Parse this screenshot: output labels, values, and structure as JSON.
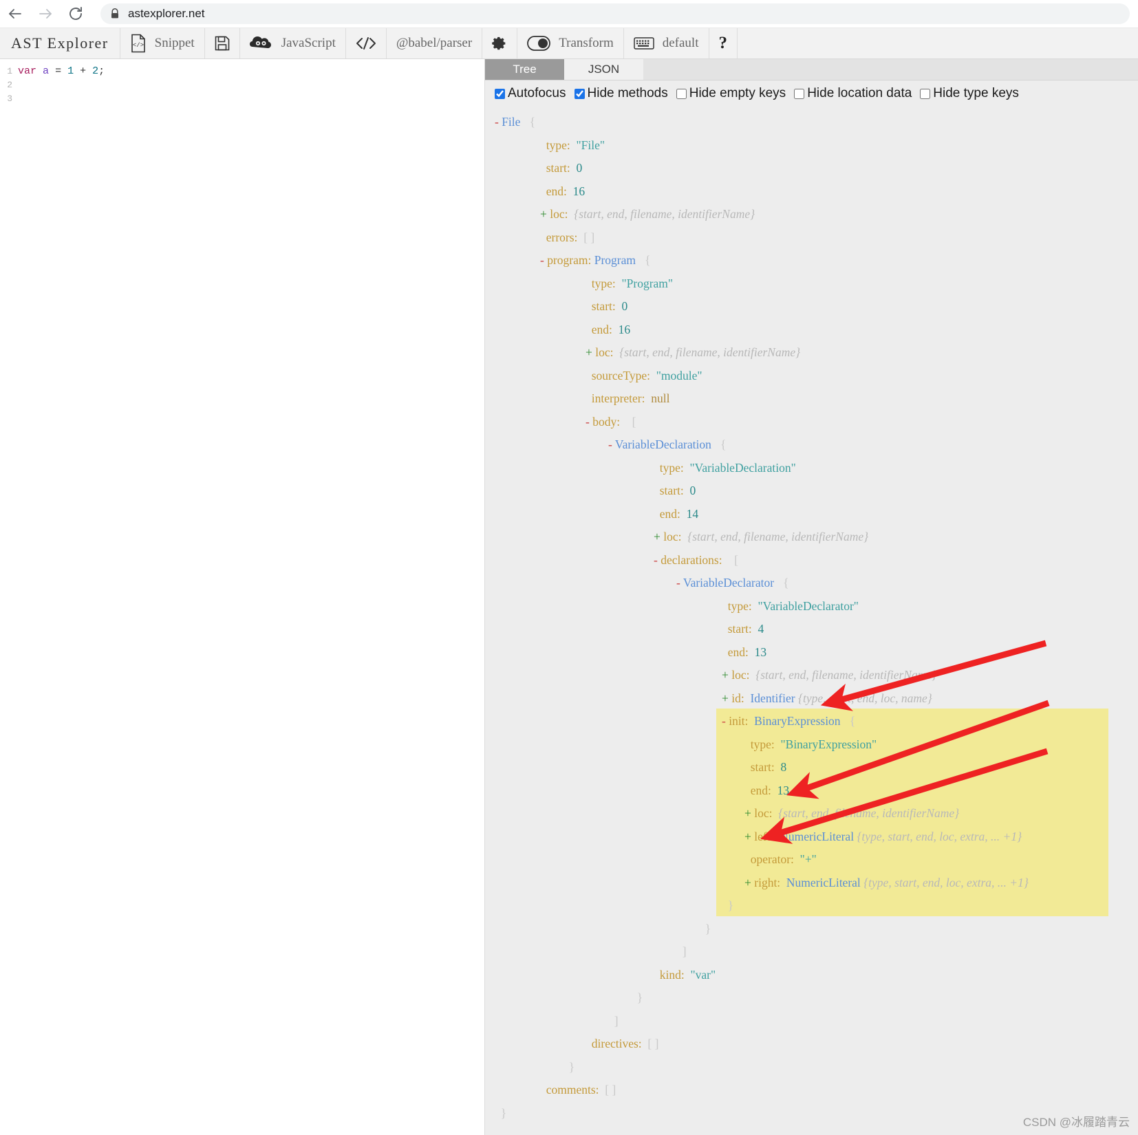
{
  "browser": {
    "back_icon": "arrow-left-icon",
    "forward_icon": "arrow-right-icon",
    "reload_icon": "reload-icon",
    "lock_icon": "lock-icon",
    "url": "astexplorer.net"
  },
  "toolbar": {
    "brand": "AST Explorer",
    "snippet_icon": "file-code-icon",
    "snippet_label": "Snippet",
    "save_icon": "floppy-disk-icon",
    "language_icon": "babel-logo-icon",
    "language_label": "JavaScript",
    "parser_icon": "code-brackets-icon",
    "parser_label": "@babel/parser",
    "settings_icon": "gear-icon",
    "transform_icon": "toggle-circle-icon",
    "transform_label": "Transform",
    "keymap_icon": "keyboard-icon",
    "keymap_label": "default",
    "help_icon": "question-mark-icon"
  },
  "editor": {
    "lines": [
      {
        "num": "1",
        "tokens": [
          {
            "t": "var",
            "c": "tok-kw"
          },
          {
            "t": " ",
            "c": "tok-punct"
          },
          {
            "t": "a",
            "c": "tok-var"
          },
          {
            "t": " ",
            "c": "tok-punct"
          },
          {
            "t": "=",
            "c": "tok-op"
          },
          {
            "t": " ",
            "c": "tok-punct"
          },
          {
            "t": "1",
            "c": "tok-num"
          },
          {
            "t": " ",
            "c": "tok-punct"
          },
          {
            "t": "+",
            "c": "tok-op"
          },
          {
            "t": " ",
            "c": "tok-punct"
          },
          {
            "t": "2",
            "c": "tok-num"
          },
          {
            "t": ";",
            "c": "tok-punct"
          }
        ],
        "plain": "var a = 1 + 2;"
      },
      {
        "num": "2",
        "tokens": [],
        "plain": ""
      },
      {
        "num": "3",
        "tokens": [],
        "plain": ""
      }
    ]
  },
  "ast_panel": {
    "tabs": [
      {
        "label": "Tree",
        "active": true
      },
      {
        "label": "JSON",
        "active": false
      }
    ],
    "options": [
      {
        "label": "Autofocus",
        "checked": true
      },
      {
        "label": "Hide methods",
        "checked": true
      },
      {
        "label": "Hide empty keys",
        "checked": false
      },
      {
        "label": "Hide location data",
        "checked": false
      },
      {
        "label": "Hide type keys",
        "checked": false
      }
    ],
    "tree_rows": [
      {
        "indent": 0,
        "toggle": "-",
        "segments": [
          {
            "text": "File",
            "cls": "nodetype"
          },
          {
            "text": "   ",
            "cls": "brace"
          },
          {
            "text": "{",
            "cls": "brace"
          }
        ]
      },
      {
        "indent": 2,
        "toggle": "",
        "segments": [
          {
            "text": "type:",
            "cls": "key"
          },
          {
            "text": "  ",
            "cls": "key"
          },
          {
            "text": "\"File\"",
            "cls": "str"
          }
        ]
      },
      {
        "indent": 2,
        "toggle": "",
        "segments": [
          {
            "text": "start:",
            "cls": "key"
          },
          {
            "text": "  ",
            "cls": "key"
          },
          {
            "text": "0",
            "cls": "num"
          }
        ]
      },
      {
        "indent": 2,
        "toggle": "",
        "segments": [
          {
            "text": "end:",
            "cls": "key"
          },
          {
            "text": "  ",
            "cls": "key"
          },
          {
            "text": "16",
            "cls": "num"
          }
        ]
      },
      {
        "indent": 2,
        "toggle": "+",
        "segments": [
          {
            "text": "loc:",
            "cls": "key"
          },
          {
            "text": "  ",
            "cls": "key"
          },
          {
            "text": "{start, end, filename, identifierName}",
            "cls": "preview"
          }
        ]
      },
      {
        "indent": 2,
        "toggle": "",
        "segments": [
          {
            "text": "errors:",
            "cls": "key"
          },
          {
            "text": "  ",
            "cls": "key"
          },
          {
            "text": "[ ]",
            "cls": "brace"
          }
        ]
      },
      {
        "indent": 2,
        "toggle": "-",
        "segments": [
          {
            "text": "program:",
            "cls": "key"
          },
          {
            "text": " ",
            "cls": "key"
          },
          {
            "text": "Program",
            "cls": "nodetype"
          },
          {
            "text": "   ",
            "cls": "brace"
          },
          {
            "text": "{",
            "cls": "brace"
          }
        ]
      },
      {
        "indent": 4,
        "toggle": "",
        "segments": [
          {
            "text": "type:",
            "cls": "key"
          },
          {
            "text": "  ",
            "cls": "key"
          },
          {
            "text": "\"Program\"",
            "cls": "str"
          }
        ]
      },
      {
        "indent": 4,
        "toggle": "",
        "segments": [
          {
            "text": "start:",
            "cls": "key"
          },
          {
            "text": "  ",
            "cls": "key"
          },
          {
            "text": "0",
            "cls": "num"
          }
        ]
      },
      {
        "indent": 4,
        "toggle": "",
        "segments": [
          {
            "text": "end:",
            "cls": "key"
          },
          {
            "text": "  ",
            "cls": "key"
          },
          {
            "text": "16",
            "cls": "num"
          }
        ]
      },
      {
        "indent": 4,
        "toggle": "+",
        "segments": [
          {
            "text": "loc:",
            "cls": "key"
          },
          {
            "text": "  ",
            "cls": "key"
          },
          {
            "text": "{start, end, filename, identifierName}",
            "cls": "preview"
          }
        ]
      },
      {
        "indent": 4,
        "toggle": "",
        "segments": [
          {
            "text": "sourceType:",
            "cls": "key"
          },
          {
            "text": "  ",
            "cls": "key"
          },
          {
            "text": "\"module\"",
            "cls": "str"
          }
        ]
      },
      {
        "indent": 4,
        "toggle": "",
        "segments": [
          {
            "text": "interpreter:",
            "cls": "key"
          },
          {
            "text": "  ",
            "cls": "key"
          },
          {
            "text": "null",
            "cls": "nul"
          }
        ]
      },
      {
        "indent": 4,
        "toggle": "-",
        "segments": [
          {
            "text": "body:",
            "cls": "key"
          },
          {
            "text": "    ",
            "cls": "key"
          },
          {
            "text": "[",
            "cls": "brace"
          }
        ]
      },
      {
        "indent": 5,
        "toggle": "-",
        "segments": [
          {
            "text": "VariableDeclaration",
            "cls": "nodetype"
          },
          {
            "text": "   ",
            "cls": "brace"
          },
          {
            "text": "{",
            "cls": "brace"
          }
        ]
      },
      {
        "indent": 7,
        "toggle": "",
        "segments": [
          {
            "text": "type:",
            "cls": "key"
          },
          {
            "text": "  ",
            "cls": "key"
          },
          {
            "text": "\"VariableDeclaration\"",
            "cls": "str"
          }
        ]
      },
      {
        "indent": 7,
        "toggle": "",
        "segments": [
          {
            "text": "start:",
            "cls": "key"
          },
          {
            "text": "  ",
            "cls": "key"
          },
          {
            "text": "0",
            "cls": "num"
          }
        ]
      },
      {
        "indent": 7,
        "toggle": "",
        "segments": [
          {
            "text": "end:",
            "cls": "key"
          },
          {
            "text": "  ",
            "cls": "key"
          },
          {
            "text": "14",
            "cls": "num"
          }
        ]
      },
      {
        "indent": 7,
        "toggle": "+",
        "segments": [
          {
            "text": "loc:",
            "cls": "key"
          },
          {
            "text": "  ",
            "cls": "key"
          },
          {
            "text": "{start, end, filename, identifierName}",
            "cls": "preview"
          }
        ]
      },
      {
        "indent": 7,
        "toggle": "-",
        "segments": [
          {
            "text": "declarations:",
            "cls": "key"
          },
          {
            "text": "    ",
            "cls": "key"
          },
          {
            "text": "[",
            "cls": "brace"
          }
        ]
      },
      {
        "indent": 8,
        "toggle": "-",
        "segments": [
          {
            "text": "VariableDeclarator",
            "cls": "nodetype"
          },
          {
            "text": "   ",
            "cls": "brace"
          },
          {
            "text": "{",
            "cls": "brace"
          }
        ]
      },
      {
        "indent": 10,
        "toggle": "",
        "segments": [
          {
            "text": "type:",
            "cls": "key"
          },
          {
            "text": "  ",
            "cls": "key"
          },
          {
            "text": "\"VariableDeclarator\"",
            "cls": "str"
          }
        ]
      },
      {
        "indent": 10,
        "toggle": "",
        "segments": [
          {
            "text": "start:",
            "cls": "key"
          },
          {
            "text": "  ",
            "cls": "key"
          },
          {
            "text": "4",
            "cls": "num"
          }
        ]
      },
      {
        "indent": 10,
        "toggle": "",
        "segments": [
          {
            "text": "end:",
            "cls": "key"
          },
          {
            "text": "  ",
            "cls": "key"
          },
          {
            "text": "13",
            "cls": "num"
          }
        ]
      },
      {
        "indent": 10,
        "toggle": "+",
        "segments": [
          {
            "text": "loc:",
            "cls": "key"
          },
          {
            "text": "  ",
            "cls": "key"
          },
          {
            "text": "{start, end, filename, identifierName}",
            "cls": "preview"
          }
        ]
      },
      {
        "indent": 10,
        "toggle": "+",
        "segments": [
          {
            "text": "id:",
            "cls": "key"
          },
          {
            "text": "  ",
            "cls": "key"
          },
          {
            "text": "Identifier",
            "cls": "nodetype"
          },
          {
            "text": " ",
            "cls": "brace"
          },
          {
            "text": "{type, start, end, loc, name}",
            "cls": "preview"
          }
        ]
      },
      {
        "indent": 10,
        "toggle": "-",
        "highlight": true,
        "segments": [
          {
            "text": "init:",
            "cls": "key"
          },
          {
            "text": "  ",
            "cls": "key"
          },
          {
            "text": "BinaryExpression",
            "cls": "nodetype"
          },
          {
            "text": "   ",
            "cls": "brace"
          },
          {
            "text": "{",
            "cls": "brace"
          }
        ]
      },
      {
        "indent": 11,
        "toggle": "",
        "highlight": true,
        "segments": [
          {
            "text": "type:",
            "cls": "key"
          },
          {
            "text": "  ",
            "cls": "key"
          },
          {
            "text": "\"BinaryExpression\"",
            "cls": "str"
          }
        ]
      },
      {
        "indent": 11,
        "toggle": "",
        "highlight": true,
        "segments": [
          {
            "text": "start:",
            "cls": "key"
          },
          {
            "text": "  ",
            "cls": "key"
          },
          {
            "text": "8",
            "cls": "num"
          }
        ]
      },
      {
        "indent": 11,
        "toggle": "",
        "highlight": true,
        "segments": [
          {
            "text": "end:",
            "cls": "key"
          },
          {
            "text": "  ",
            "cls": "key"
          },
          {
            "text": "13",
            "cls": "num"
          }
        ]
      },
      {
        "indent": 11,
        "toggle": "+",
        "highlight": true,
        "segments": [
          {
            "text": "loc:",
            "cls": "key"
          },
          {
            "text": "  ",
            "cls": "key"
          },
          {
            "text": "{start, end, filename, identifierName}",
            "cls": "preview"
          }
        ]
      },
      {
        "indent": 11,
        "toggle": "+",
        "highlight": true,
        "segments": [
          {
            "text": "left:",
            "cls": "key"
          },
          {
            "text": "  ",
            "cls": "key"
          },
          {
            "text": "NumericLiteral",
            "cls": "nodetype"
          },
          {
            "text": " ",
            "cls": "brace"
          },
          {
            "text": "{type, start, end, loc, extra, ... +1}",
            "cls": "preview"
          }
        ]
      },
      {
        "indent": 11,
        "toggle": "",
        "highlight": true,
        "segments": [
          {
            "text": "operator:",
            "cls": "key"
          },
          {
            "text": "  ",
            "cls": "key"
          },
          {
            "text": "\"+\"",
            "cls": "str"
          }
        ]
      },
      {
        "indent": 11,
        "toggle": "+",
        "highlight": true,
        "segments": [
          {
            "text": "right:",
            "cls": "key"
          },
          {
            "text": "  ",
            "cls": "key"
          },
          {
            "text": "NumericLiteral",
            "cls": "nodetype"
          },
          {
            "text": " ",
            "cls": "brace"
          },
          {
            "text": "{type, start, end, loc, extra, ... +1}",
            "cls": "preview"
          }
        ]
      },
      {
        "indent": 10,
        "toggle": "",
        "highlight": true,
        "segments": [
          {
            "text": "}",
            "cls": "brace"
          }
        ]
      },
      {
        "indent": 9,
        "toggle": "",
        "segments": [
          {
            "text": "}",
            "cls": "brace"
          }
        ]
      },
      {
        "indent": 8,
        "toggle": "",
        "segments": [
          {
            "text": "]",
            "cls": "brace"
          }
        ]
      },
      {
        "indent": 7,
        "toggle": "",
        "segments": [
          {
            "text": "kind:",
            "cls": "key"
          },
          {
            "text": "  ",
            "cls": "key"
          },
          {
            "text": "\"var\"",
            "cls": "str"
          }
        ]
      },
      {
        "indent": 6,
        "toggle": "",
        "segments": [
          {
            "text": "}",
            "cls": "brace"
          }
        ]
      },
      {
        "indent": 5,
        "toggle": "",
        "segments": [
          {
            "text": "]",
            "cls": "brace"
          }
        ]
      },
      {
        "indent": 4,
        "toggle": "",
        "segments": [
          {
            "text": "directives:",
            "cls": "key"
          },
          {
            "text": "  ",
            "cls": "key"
          },
          {
            "text": "[ ]",
            "cls": "brace"
          }
        ]
      },
      {
        "indent": 3,
        "toggle": "",
        "segments": [
          {
            "text": "}",
            "cls": "brace"
          }
        ]
      },
      {
        "indent": 2,
        "toggle": "",
        "segments": [
          {
            "text": "comments:",
            "cls": "key"
          },
          {
            "text": "  ",
            "cls": "key"
          },
          {
            "text": "[ ]",
            "cls": "brace"
          }
        ]
      },
      {
        "indent": 0,
        "toggle": "",
        "segments": [
          {
            "text": "}",
            "cls": "brace"
          }
        ]
      }
    ],
    "highlight_color": "#f2ea96",
    "annotation_arrow_color": "#ee2222",
    "annotation_arrows": 3
  },
  "watermark": "CSDN @冰履踏青云"
}
